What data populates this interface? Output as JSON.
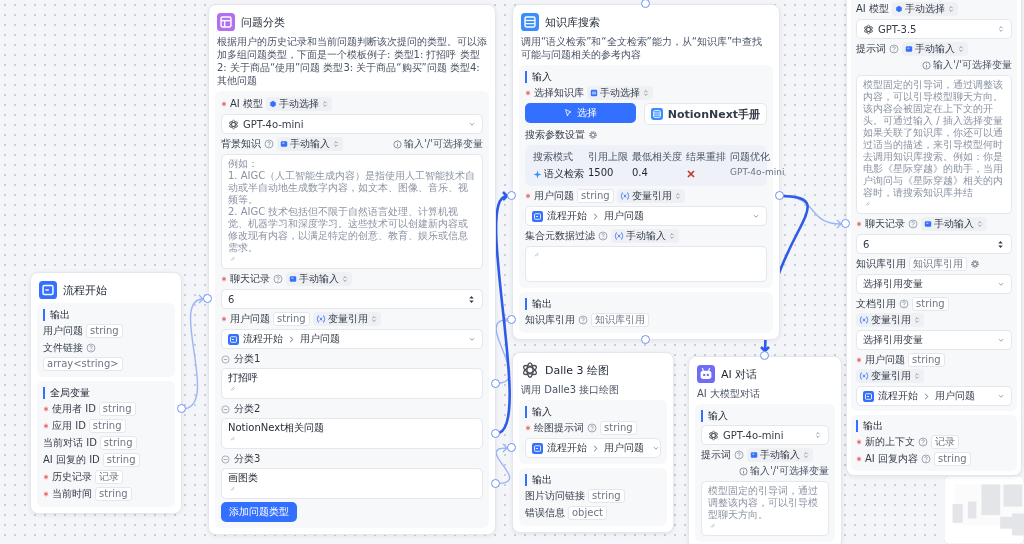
{
  "nodes": [
    {
      "title": "流程开始",
      "sections": [
        {
          "title": "输出",
          "rows": [
            {
              "kind": "field",
              "label": "用户问题",
              "required": false,
              "help": false,
              "gear": false,
              "type": "string"
            },
            {
              "kind": "field",
              "label": "文件链接",
              "required": false,
              "help": true,
              "gear": false,
              "type": "array<string>"
            }
          ]
        },
        {
          "title": "全局变量",
          "rows": [
            {
              "kind": "field",
              "label": "使用者 ID",
              "required": true,
              "help": false,
              "gear": false,
              "type": "string"
            },
            {
              "kind": "field",
              "label": "应用 ID",
              "required": true,
              "help": false,
              "gear": false,
              "type": "string"
            },
            {
              "kind": "field",
              "label": "当前对话 ID",
              "required": false,
              "help": false,
              "gear": false,
              "type": "string"
            },
            {
              "kind": "field",
              "label": "AI 回复的 ID",
              "required": false,
              "help": false,
              "gear": false,
              "type": "string"
            },
            {
              "kind": "field",
              "label": "历史记录",
              "required": true,
              "help": false,
              "gear": false,
              "type": "记录"
            },
            {
              "kind": "field",
              "label": "当前时间",
              "required": true,
              "help": false,
              "gear": false,
              "type": "string"
            }
          ]
        }
      ]
    },
    {
      "title": "问题分类",
      "description": "根据用户的历史记录和当前问题判断该次提问的类型。可以添加多组问题类型，下面是一个模板例子: 类型1: 打招呼 类型2: 关于商品“使用”问题 类型3: 关于商品“购买”问题 类型4: 其他问题",
      "sections": [
        {
          "rows": [
            {
              "kind": "field",
              "label": "AI 模型",
              "required": true,
              "help": false,
              "gear": false,
              "mode": "手动选择"
            },
            {
              "kind": "select",
              "value": "GPT-4o-mini"
            },
            {
              "kind": "field",
              "label": "背景知识",
              "required": false,
              "help": true,
              "gear": false,
              "mode": "手动输入",
              "hint": "输入'/'可选择变量"
            },
            {
              "kind": "textarea",
              "placeholder": "例如：\n1. AIGC（人工智能生成内容）是指使用人工智能技术自动或半自动地生成数字内容，如文本、图像、音乐、视频等。\n2. AIGC 技术包括但不限于自然语言处理、计算机视觉、机器学习和深度学习。这些技术可以创建新内容或修改现有内容，以满足特定的创意、教育、娱乐或信息需求。"
            },
            {
              "kind": "field",
              "label": "聊天记录",
              "required": true,
              "help": true,
              "gear": false,
              "mode": "手动输入"
            },
            {
              "kind": "number",
              "value": "6"
            },
            {
              "kind": "field",
              "label": "用户问题",
              "required": true,
              "help": false,
              "gear": false,
              "type": "string",
              "mode": "变量引用"
            },
            {
              "kind": "ref",
              "source": "流程开始",
              "field": "用户问题"
            },
            {
              "kind": "category",
              "label": "分类1",
              "value": "打招呼"
            },
            {
              "kind": "category",
              "label": "分类2",
              "value": "NotionNext相关问题"
            },
            {
              "kind": "category",
              "label": "分类3",
              "value": "画图类"
            },
            {
              "kind": "button",
              "label": "添加问题类型"
            }
          ]
        }
      ]
    },
    {
      "title": "知识库搜索",
      "description": "调用“语义检索”和“全文检索”能力，从“知识库”中查找可能与问题相关的参考内容",
      "sections": [
        {
          "title": "输入",
          "rows": [
            {
              "kind": "field",
              "label": "选择知识库",
              "required": true,
              "help": false,
              "gear": false,
              "mode": "手动选择"
            },
            {
              "kind": "kb_picker",
              "button": "选择",
              "dataset": "NotionNext手册"
            },
            {
              "kind": "field",
              "label": "搜索参数设置",
              "required": false,
              "help": false,
              "gear": true
            },
            {
              "kind": "params",
              "columns": [
                "搜索模式",
                "引用上限",
                "最低相关度",
                "结果重排",
                "问题优化"
              ],
              "mode": "语义检索",
              "limit": "1500",
              "similarity": "0.4",
              "rerank": false,
              "optimize": "GPT-4o-mini"
            },
            {
              "kind": "field",
              "label": "用户问题",
              "required": true,
              "help": false,
              "gear": false,
              "type": "string",
              "mode": "变量引用"
            },
            {
              "kind": "ref",
              "source": "流程开始",
              "field": "用户问题"
            },
            {
              "kind": "field",
              "label": "集合元数据过滤",
              "required": false,
              "help": true,
              "gear": false,
              "mode": "手动输入"
            },
            {
              "kind": "textarea"
            }
          ]
        },
        {
          "title": "输出",
          "rows": [
            {
              "kind": "field",
              "label": "知识库引用",
              "required": false,
              "help": true,
              "gear": false,
              "type": "知识库引用"
            }
          ]
        }
      ]
    },
    {
      "title": "Dalle 3 绘图",
      "description": "调用 Dalle3 接口绘图",
      "sections": [
        {
          "title": "输入",
          "rows": [
            {
              "kind": "field",
              "label": "绘图提示词",
              "required": true,
              "help": true,
              "gear": false,
              "type": "string"
            },
            {
              "kind": "ref",
              "source": "流程开始",
              "field": "用户问题"
            }
          ]
        },
        {
          "title": "输出",
          "rows": [
            {
              "kind": "field",
              "label": "图片访问链接",
              "required": false,
              "help": false,
              "gear": false,
              "type": "string"
            },
            {
              "kind": "field",
              "label": "错误信息",
              "required": false,
              "help": false,
              "gear": false,
              "type": "object"
            }
          ]
        }
      ]
    },
    {
      "title": "AI 对话",
      "description": "AI 大模型对话",
      "sections": [
        {
          "title": "输入",
          "rows": [
            {
              "kind": "select",
              "value": "GPT-4o-mini"
            },
            {
              "kind": "field",
              "label": "提示词",
              "required": false,
              "help": true,
              "gear": false,
              "mode": "手动输入",
              "hint": "输入'/'可选择变量"
            },
            {
              "kind": "textarea",
              "placeholder": "模型固定的引导词，通过调整该内容，可以引导模型聊天方向。"
            }
          ]
        }
      ]
    },
    {
      "sections": [
        {
          "rows": [
            {
              "kind": "field",
              "label": "AI 模型",
              "required": false,
              "help": false,
              "gear": false,
              "mode": "手动选择"
            },
            {
              "kind": "select",
              "value": "GPT-3.5"
            },
            {
              "kind": "field",
              "label": "提示词",
              "required": false,
              "help": true,
              "gear": false,
              "mode": "手动输入",
              "hint": "输入'/'可选择变量"
            },
            {
              "kind": "textarea",
              "placeholder": "模型固定的引导词，通过调整该内容，可以引导模型聊天方向。该内容会被固定在上下文的开头。可通过输入 / 插入选择变量如果关联了知识库，你还可以通过适当的描述，来引导模型何时去调用知识库搜索。例如：你是电影《星际穿越》的助手，当用户询问与《星际穿越》相关的内容时，请搜索知识库并结"
            },
            {
              "kind": "field",
              "label": "聊天记录",
              "required": true,
              "help": true,
              "gear": false,
              "mode": "手动输入"
            },
            {
              "kind": "number",
              "value": "6"
            },
            {
              "kind": "field",
              "label": "知识库引用",
              "required": false,
              "help": false,
              "gear": true,
              "type": "知识库引用"
            },
            {
              "kind": "select",
              "value": "选择引用变量"
            },
            {
              "kind": "field",
              "label": "文档引用",
              "required": false,
              "help": true,
              "gear": false,
              "type": "string",
              "mode": "变量引用"
            },
            {
              "kind": "select",
              "value": "选择引用变量"
            },
            {
              "kind": "field",
              "label": "用户问题",
              "required": true,
              "help": false,
              "gear": false,
              "type": "string",
              "mode": "变量引用"
            },
            {
              "kind": "ref",
              "source": "流程开始",
              "field": "用户问题"
            }
          ]
        },
        {
          "title": "输出",
          "rows": [
            {
              "kind": "field",
              "label": "新的上下文",
              "required": true,
              "help": true,
              "gear": false,
              "type": "记录"
            },
            {
              "kind": "field",
              "label": "AI 回复内容",
              "required": true,
              "help": true,
              "gear": false,
              "type": "string"
            }
          ]
        }
      ]
    }
  ],
  "connections": [
    {
      "highlighted": false
    },
    {
      "highlighted": false
    },
    {
      "highlighted": true
    },
    {
      "highlighted": false
    },
    {
      "highlighted": false
    },
    {
      "highlighted": true
    }
  ]
}
